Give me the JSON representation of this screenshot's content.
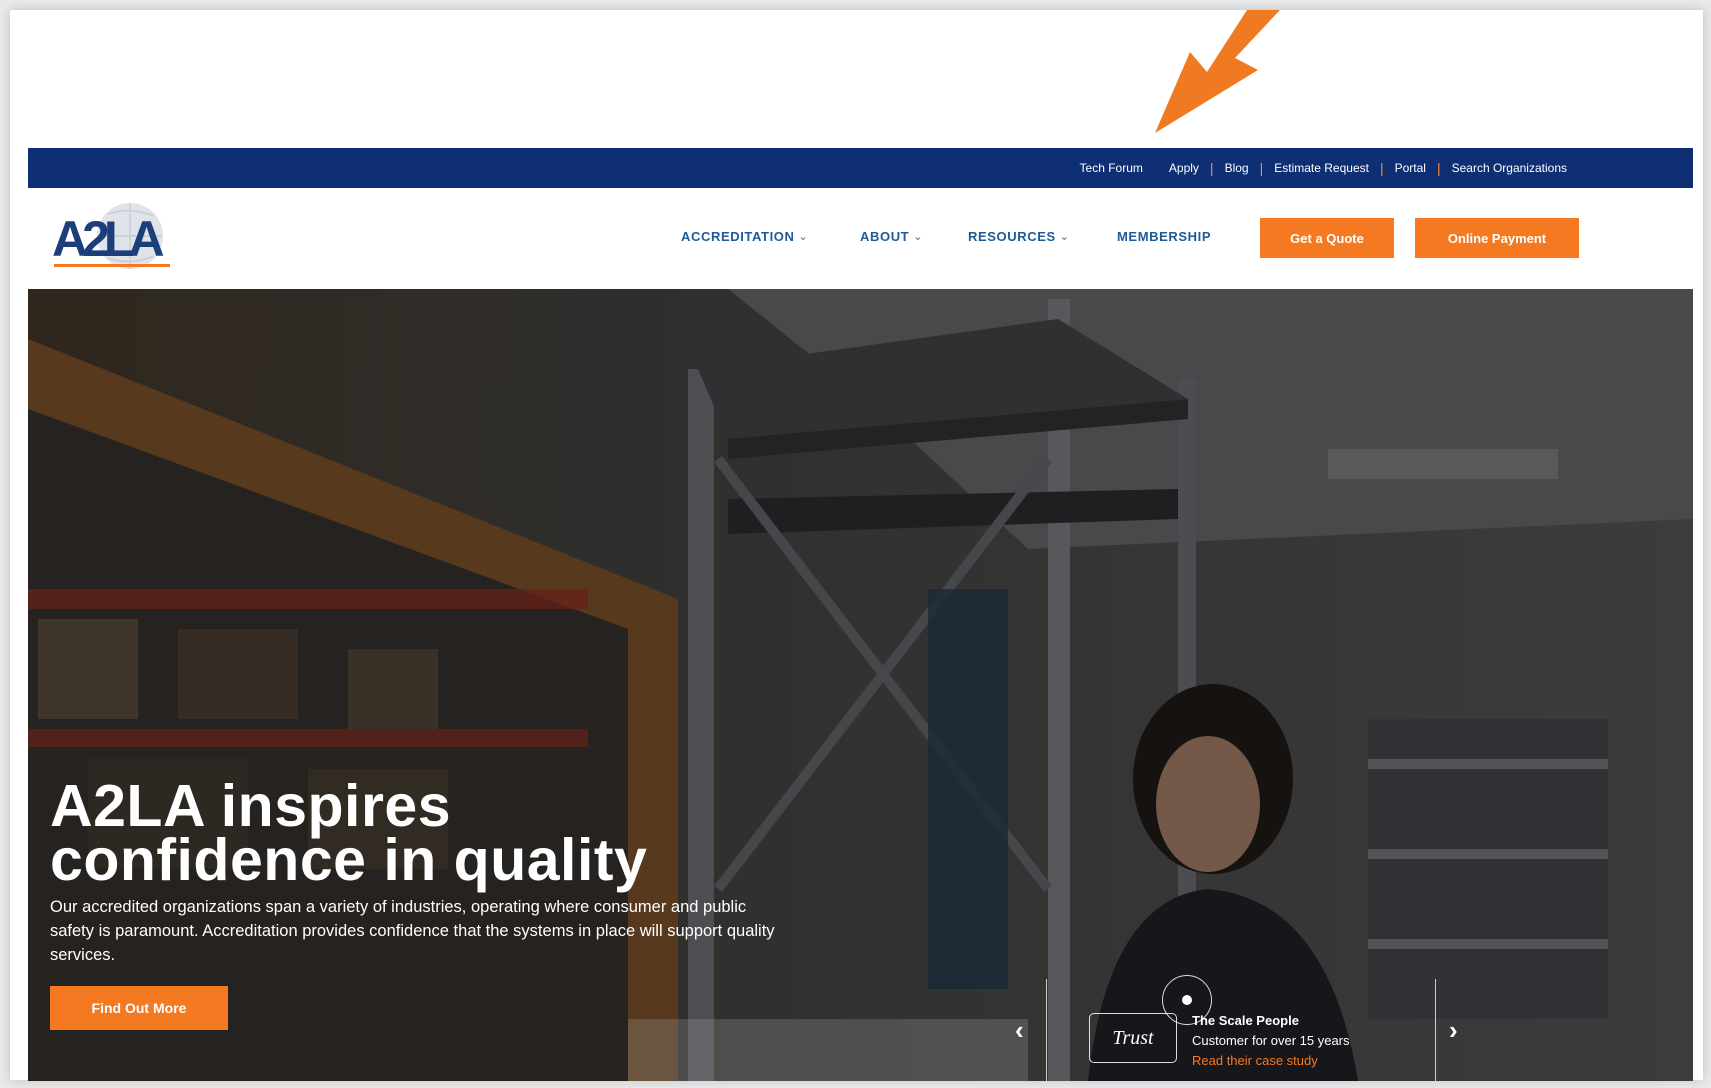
{
  "accent": "#f47920",
  "navy": "#0e2f73",
  "utility_nav": {
    "items": [
      "Tech Forum",
      "Apply",
      "Blog",
      "Estimate Request",
      "Portal",
      "Search Organizations"
    ]
  },
  "logo": {
    "text": "A2LA"
  },
  "main_nav": {
    "items": [
      {
        "label": "ACCREDITATION",
        "has_dropdown": true
      },
      {
        "label": "ABOUT",
        "has_dropdown": true
      },
      {
        "label": "RESOURCES",
        "has_dropdown": true
      },
      {
        "label": "MEMBERSHIP",
        "has_dropdown": false
      }
    ],
    "quote_button": "Get a Quote",
    "payment_button": "Online Payment"
  },
  "hero": {
    "title_line1": "A2LA inspires",
    "title_line2": "confidence in quality",
    "body": "Our accredited organizations span a variety of industries, operating where consumer and public safety is paramount. Accreditation provides confidence that the systems in place will support quality services.",
    "cta": "Find Out More"
  },
  "testimonial": {
    "badge": "Trust",
    "company": "The Scale People",
    "subtitle": "Customer for over 15 years",
    "link": "Read their case study",
    "prev_icon": "chevron-left-icon",
    "next_icon": "chevron-right-icon"
  }
}
